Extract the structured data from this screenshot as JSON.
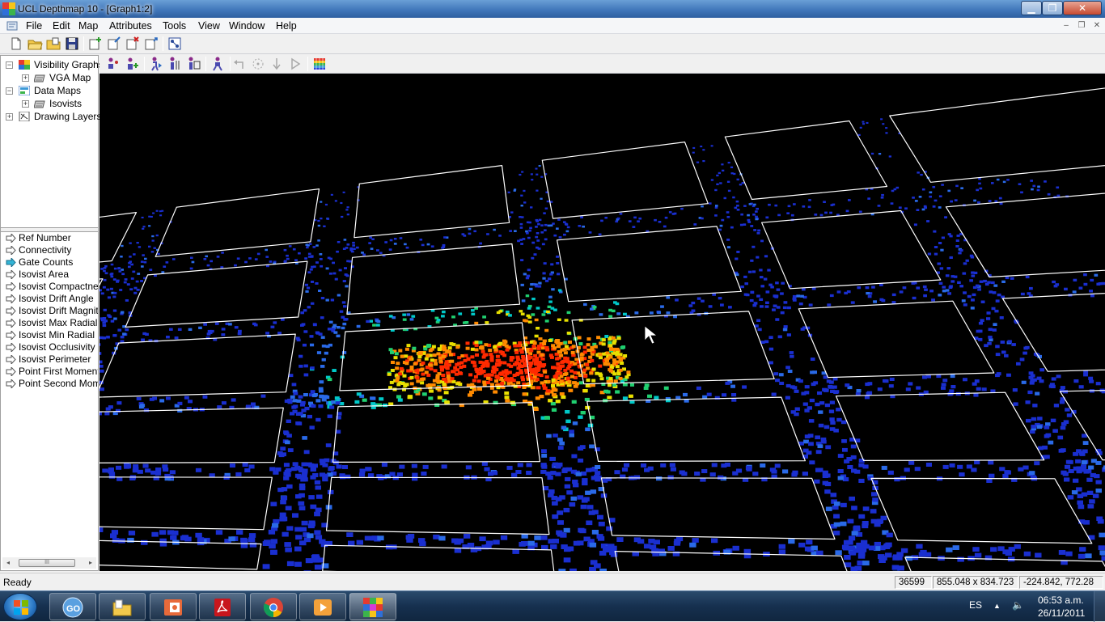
{
  "window": {
    "title": "UCL Depthmap 10 - [Graph1:2]",
    "controls": {
      "minimize": "▁",
      "maximize": "❐",
      "close": "✕"
    }
  },
  "menu": [
    "File",
    "Edit",
    "Map",
    "Attributes",
    "Tools",
    "View",
    "Window",
    "Help"
  ],
  "mdi_controls": [
    "–",
    "❐",
    "✕"
  ],
  "toolbar1": {
    "icons": [
      "new-file-icon",
      "open-folder-icon",
      "open-copy-icon",
      "save-icon",
      "add-map-icon",
      "edit-map-icon",
      "delete-map-icon",
      "export-map-icon",
      "graph-settings-icon"
    ]
  },
  "toolbar2": {
    "icons": [
      "fill-agents-icon",
      "add-agent-icon",
      "walk-agent-icon",
      "step-agent-icon",
      "isovist-agent-icon",
      "run-agent-icon",
      "undo-icon",
      "select-icon",
      "move-down-icon",
      "play-icon",
      "color-grid-icon"
    ]
  },
  "tree": [
    {
      "label": "Visibility Graphs",
      "expander": "−",
      "icon": "visibility-graph-icon",
      "level": 0
    },
    {
      "label": "VGA Map",
      "expander": "+",
      "icon": "layer-icon",
      "level": 1
    },
    {
      "label": "Data Maps",
      "expander": "−",
      "icon": "data-map-icon",
      "level": 0
    },
    {
      "label": "Isovists",
      "expander": "+",
      "icon": "layer-icon",
      "level": 1
    },
    {
      "label": "Drawing Layers",
      "expander": "+",
      "icon": "drawing-layer-icon",
      "level": 0
    }
  ],
  "attributes": [
    {
      "label": "Ref Number",
      "selected": false
    },
    {
      "label": "Connectivity",
      "selected": false
    },
    {
      "label": "Gate Counts",
      "selected": true
    },
    {
      "label": "Isovist Area",
      "selected": false
    },
    {
      "label": "Isovist Compactness",
      "selected": false
    },
    {
      "label": "Isovist Drift Angle",
      "selected": false
    },
    {
      "label": "Isovist Drift Magnitude",
      "selected": false
    },
    {
      "label": "Isovist Max Radial",
      "selected": false
    },
    {
      "label": "Isovist Min Radial",
      "selected": false
    },
    {
      "label": "Isovist Occlusivity",
      "selected": false
    },
    {
      "label": "Isovist Perimeter",
      "selected": false
    },
    {
      "label": "Point First Moment",
      "selected": false
    },
    {
      "label": "Point Second Moment",
      "selected": false
    }
  ],
  "scrollbar": {
    "left": "◂",
    "right": "▸",
    "thumb": "III"
  },
  "colors": {
    "viewport_bg": "#000000",
    "street_outline": "#ffffff",
    "heat_low": "#1a2fd0",
    "heat_mid": "#00c8c8",
    "heat_high": "#ff2a00",
    "selected_arrow": "#33b5d6"
  },
  "status": {
    "text": "Ready",
    "count": "36599",
    "size": "855.048 x 834.723",
    "coords": "-224.842, 772.28"
  },
  "taskbar": {
    "apps": [
      "start-orb",
      "go-app-icon",
      "file-explorer-icon",
      "presentation-app-icon",
      "pdf-reader-icon",
      "chrome-icon",
      "media-player-icon",
      "depthmap-app-icon"
    ],
    "lang": "ES",
    "tray_up": "▲",
    "volume": "🔈",
    "time": "06:53 a.m.",
    "date": "26/11/2011"
  }
}
